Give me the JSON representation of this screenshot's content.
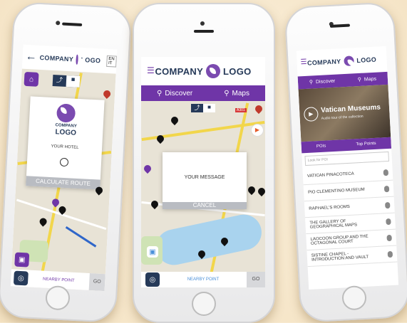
{
  "brand": {
    "company": "COMPANY",
    "logo": "LOGO",
    "accent": "#6f35a7",
    "navy": "#263a59"
  },
  "left_phone": {
    "back_icon": "left-arrow-icon",
    "lang_options": [
      "EN",
      "IT"
    ],
    "modal_logo_company": "COMPANY",
    "modal_logo": "LOGO",
    "your_hotel": "YOUR HOTEL",
    "calculate_route": "CALCULATE ROUTE",
    "nearby_label": "NEARBY POINT",
    "go_label": "GO"
  },
  "middle_phone": {
    "nav_discover": "Discover",
    "nav_maps": "Maps",
    "message": "YOUR MESSAGE",
    "cancel": "CANCEL",
    "nearby_label": "NEARBY POINT",
    "go_label": "GO",
    "road_tag": "A301"
  },
  "right_phone": {
    "nav_discover": "Discover",
    "nav_maps": "Maps",
    "hero_title": "Vatican Museums",
    "hero_subtitle": "Audio tour of the collection",
    "tab_pois": "POIs",
    "tab_tours": "Top Points",
    "search_placeholder": "Look for POI",
    "items": [
      "VATICAN PINACOTECA",
      "PIO CLEMENTINO MUSEUM",
      "RAPHAEL'S ROOMS",
      "THE GALLERY OF GEOGRAPHICAL MAPS",
      "LAOCOON GROUP AND THE OCTAGONAL COURT",
      "SISTINE CHAPEL - INTRODUCTION AND VAULT"
    ]
  }
}
